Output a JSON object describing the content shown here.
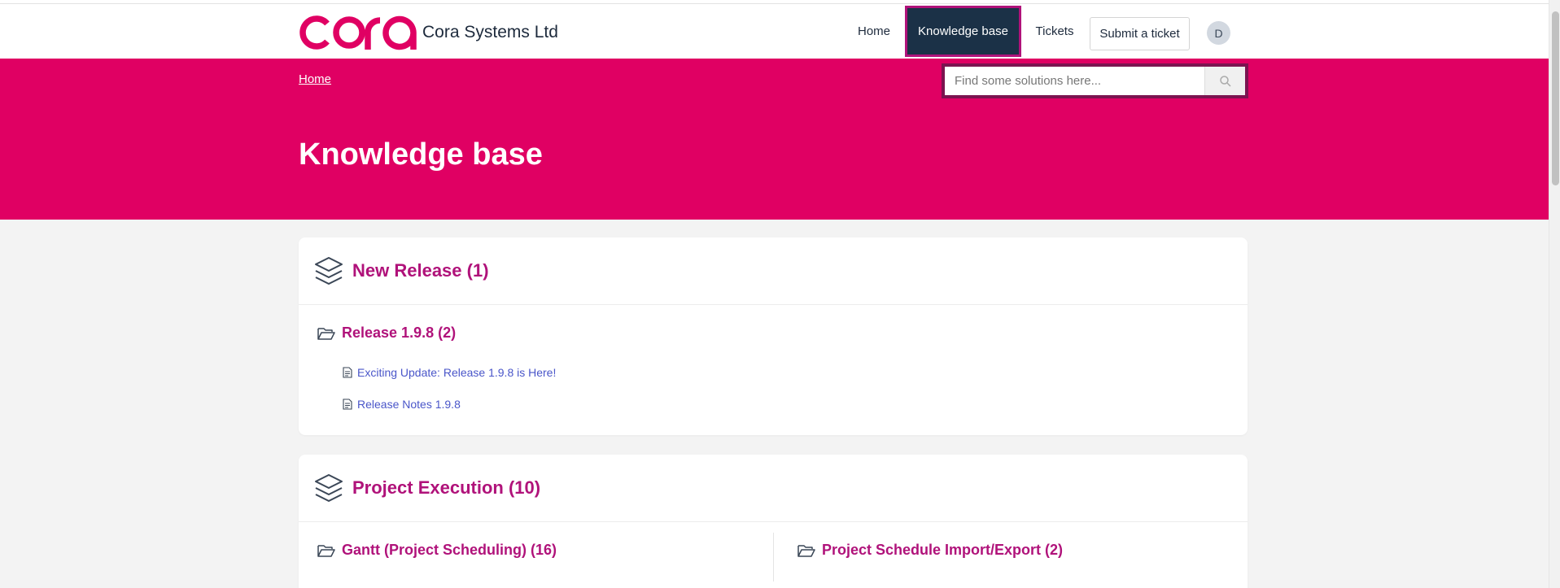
{
  "header": {
    "company_name": "Cora Systems Ltd",
    "nav": {
      "home": "Home",
      "knowledge_base": "Knowledge base",
      "tickets": "Tickets",
      "submit_ticket": "Submit a ticket"
    },
    "avatar_initial": "D"
  },
  "hero": {
    "breadcrumb": "Home",
    "search_placeholder": "Find some solutions here...",
    "title": "Knowledge base"
  },
  "categories": [
    {
      "title": "New Release (1)",
      "folders": [
        {
          "title": "Release 1.9.8 (2)",
          "articles": [
            "Exciting Update: Release 1.9.8 is Here!",
            "Release Notes 1.9.8"
          ]
        }
      ]
    },
    {
      "title": "Project Execution (10)",
      "folders": [
        {
          "title": "Gantt (Project Scheduling) (16)"
        },
        {
          "title": "Project Schedule Import/Export (2)"
        }
      ]
    }
  ],
  "colors": {
    "brand": "#e00063",
    "link": "#b0127a",
    "nav_active_bg": "#1b3147",
    "article_link": "#4a56c9"
  },
  "icons": [
    "headset-icon",
    "search-icon",
    "layers-icon",
    "folder-open-icon",
    "document-icon"
  ]
}
